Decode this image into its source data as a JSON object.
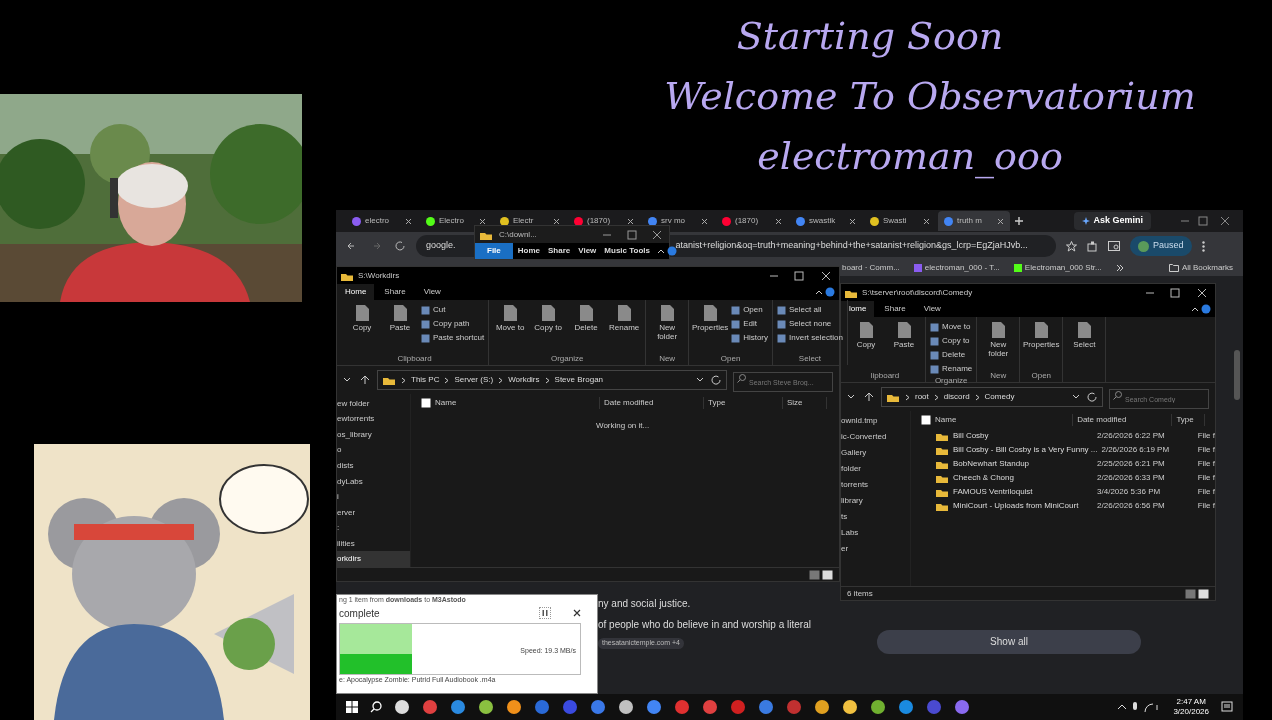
{
  "overlay": {
    "title_lines": [
      "Starting Soon",
      "Welcome To Observatorium",
      "electroman_ooo"
    ],
    "webcam": {
      "kind": "picture"
    },
    "poster": {
      "kind": "picture"
    }
  },
  "browser": {
    "tabs": [
      {
        "label": "electro",
        "selected": false
      },
      {
        "label": "Electro",
        "selected": false
      },
      {
        "label": "Electr",
        "selected": false
      },
      {
        "label": "(1870)",
        "selected": false
      },
      {
        "label": "srv mo",
        "selected": false
      },
      {
        "label": "(1870)",
        "selected": false
      },
      {
        "label": "swastik",
        "selected": false
      },
      {
        "label": "Swasti",
        "selected": false
      },
      {
        "label": "truth m",
        "selected": true
      }
    ],
    "ask": "Ask Gemini",
    "url_left": "google.",
    "url_right": "atanist+religion&oq=truth+meaning+behind+the+satanist+religion&gs_lcrp=EgZjaHJvb...",
    "profile": "Paused",
    "bookmarks": [
      "board · Comm...",
      "electroman_000 - T...",
      "Electroman_000 Str..."
    ],
    "all_bookmarks": "All Bookmarks",
    "page_lines": [
      "ny and social justice.",
      "of people who do believe in and worship a literal"
    ],
    "source": "thesatanictemple.com +4",
    "show_all": "Show all"
  },
  "mini_explorer": {
    "path": "C:\\downl...",
    "ribbon_tabs": [
      {
        "label": "File",
        "selected": true
      },
      {
        "label": "Home",
        "selected": false
      },
      {
        "label": "Share",
        "selected": false
      },
      {
        "label": "View",
        "selected": false
      },
      {
        "label": "Music Tools",
        "selected": false
      }
    ]
  },
  "explorer_left": {
    "title": "S:\\Workdirs",
    "ribbon_tabs": [
      {
        "label": "Home",
        "selected": true
      },
      {
        "label": "Share",
        "selected": false
      },
      {
        "label": "View",
        "selected": false
      }
    ],
    "ribbon_groups": [
      {
        "label": "Clipboard",
        "buttons": [
          {
            "label": "Copy",
            "kind": "large"
          },
          {
            "label": "Paste",
            "kind": "large"
          },
          {
            "label": "Cut",
            "kind": "small"
          },
          {
            "label": "Copy path",
            "kind": "small"
          },
          {
            "label": "Paste shortcut",
            "kind": "small"
          }
        ]
      },
      {
        "label": "Organize",
        "buttons": [
          {
            "label": "Move to",
            "kind": "large"
          },
          {
            "label": "Copy to",
            "kind": "large"
          },
          {
            "label": "Delete",
            "kind": "large"
          },
          {
            "label": "Rename",
            "kind": "large"
          }
        ]
      },
      {
        "label": "New",
        "buttons": [
          {
            "label": "New folder",
            "kind": "large"
          }
        ]
      },
      {
        "label": "Open",
        "buttons": [
          {
            "label": "Properties",
            "kind": "large"
          },
          {
            "label": "Open",
            "kind": "small"
          },
          {
            "label": "Edit",
            "kind": "small"
          },
          {
            "label": "History",
            "kind": "small"
          }
        ]
      },
      {
        "label": "Select",
        "buttons": [
          {
            "label": "Select all",
            "kind": "small"
          },
          {
            "label": "Select none",
            "kind": "small"
          },
          {
            "label": "Invert selection",
            "kind": "small"
          }
        ]
      }
    ],
    "breadcrumb": [
      "This PC",
      "Server (S:)",
      "Workdirs",
      "Steve Brogan"
    ],
    "search_placeholder": "Search Steve Brog...",
    "sidebar": [
      {
        "label": "ew folder",
        "selected": false
      },
      {
        "label": "ewtorrents",
        "selected": false
      },
      {
        "label": "os_library",
        "selected": false
      },
      {
        "label": "o",
        "selected": false
      },
      {
        "label": "dists",
        "selected": false
      },
      {
        "label": "dyLabs",
        "selected": false
      },
      {
        "label": "i",
        "selected": false
      },
      {
        "label": "erver",
        "selected": false
      },
      {
        "label": ":",
        "selected": false
      },
      {
        "label": "ilities",
        "selected": false
      },
      {
        "label": "orkdirs",
        "selected": true
      }
    ],
    "columns": [
      "Name",
      "Date modified",
      "Type",
      "Size"
    ],
    "status": "Working on it..."
  },
  "explorer_right": {
    "title": "S:\\tserver\\root\\discord\\Comedy",
    "ribbon_tabs": [
      {
        "label": "lome",
        "selected": true
      },
      {
        "label": "Share",
        "selected": false
      },
      {
        "label": "View",
        "selected": false
      }
    ],
    "ribbon_groups": [
      {
        "label": "lipboard",
        "buttons": [
          {
            "label": "Copy",
            "kind": "large"
          },
          {
            "label": "Paste",
            "kind": "large"
          }
        ]
      },
      {
        "label": "Organize",
        "buttons": [
          {
            "label": "Move to",
            "kind": "small"
          },
          {
            "label": "Copy to",
            "kind": "small"
          },
          {
            "label": "Delete",
            "kind": "small"
          },
          {
            "label": "Rename",
            "kind": "small"
          }
        ]
      },
      {
        "label": "New",
        "buttons": [
          {
            "label": "New folder",
            "kind": "large"
          }
        ]
      },
      {
        "label": "Open",
        "buttons": [
          {
            "label": "Properties",
            "kind": "large"
          }
        ]
      },
      {
        "buttons": [
          {
            "label": "Select",
            "kind": "large"
          }
        ]
      }
    ],
    "breadcrumb": [
      "root",
      "discord",
      "Comedy"
    ],
    "search_placeholder": "Search Comedy",
    "sidebar": [
      {
        "label": "ownld.tmp",
        "selected": false
      },
      {
        "label": "ic-Converted",
        "selected": false
      },
      {
        "label": "Gallery",
        "selected": false
      },
      {
        "label": "folder",
        "selected": false
      },
      {
        "label": "torrents",
        "selected": false
      },
      {
        "label": "library",
        "selected": false
      },
      {
        "label": "ts",
        "selected": false
      },
      {
        "label": "Labs",
        "selected": false
      },
      {
        "label": "er",
        "selected": false
      }
    ],
    "columns": [
      "Name",
      "Date modified",
      "Type"
    ],
    "rows": [
      {
        "name": "Bill Cosby",
        "date": "2/26/2026 6:22 PM",
        "type": "File f"
      },
      {
        "name": "Bill Cosby - Bill Cosby is a Very Funny ...",
        "date": "2/26/2026 6:19 PM",
        "type": "File f"
      },
      {
        "name": "BobNewhart Standup",
        "date": "2/25/2026 6:21 PM",
        "type": "File f"
      },
      {
        "name": "Cheech & Chong",
        "date": "2/26/2026 6:33 PM",
        "type": "File f"
      },
      {
        "name": "FAMOUS Ventriloquist",
        "date": "3/4/2026 5:36 PM",
        "type": "File f"
      },
      {
        "name": "MiniCourt - Uploads from MiniCourt",
        "date": "2/26/2026 6:56 PM",
        "type": "File f"
      }
    ],
    "item_count": "6 items"
  },
  "copy_dialog": {
    "from_line": "ng 1 item from **downloads** to **M3Astodo**",
    "heading": "complete",
    "speed": "Speed: 19.3 MB/s",
    "level": 0.3,
    "file": "e: Apocalypse Zombie: Putrid Full Audiobook .m4a"
  },
  "taskbar": {
    "time": "2:47 AM",
    "date": "3/20/2026"
  }
}
